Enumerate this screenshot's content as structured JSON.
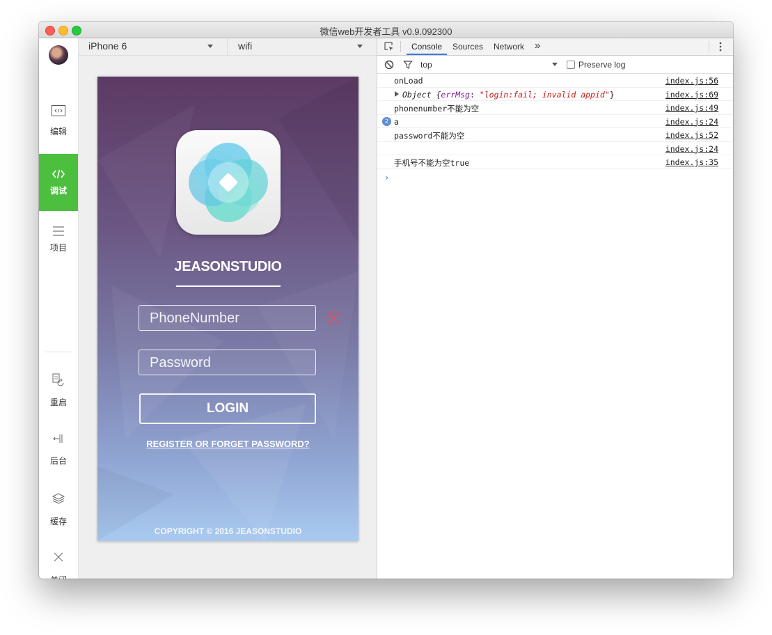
{
  "window": {
    "title": "微信web开发者工具 v0.9.092300"
  },
  "sidebar": {
    "items": [
      {
        "label": "编辑",
        "icon": "code-box-icon"
      },
      {
        "label": "调试",
        "icon": "debug-code-icon"
      },
      {
        "label": "项目",
        "icon": "menu-lines-icon"
      },
      {
        "label": "重启",
        "icon": "restart-icon"
      },
      {
        "label": "后台",
        "icon": "background-icon"
      },
      {
        "label": "缓存",
        "icon": "layers-icon"
      },
      {
        "label": "关闭",
        "icon": "close-icon"
      }
    ],
    "active_color": "#4cbf3f"
  },
  "simulator": {
    "device": "iPhone 6",
    "network": "wifi",
    "app": {
      "brand": "JEASONSTUDIO",
      "phone_placeholder": "PhoneNumber",
      "password_placeholder": "Password",
      "login_label": "LOGIN",
      "register_link": "REGISTER OR FORGET PASSWORD?",
      "copyright": "COPYRIGHT © 2016 JEASONSTUDIO"
    }
  },
  "devtools": {
    "tabs": [
      "Console",
      "Sources",
      "Network"
    ],
    "more": "»",
    "context": "top",
    "preserve_log": "Preserve log",
    "console": [
      {
        "msg": "onLoad",
        "src": "index.js:56"
      },
      {
        "msg_prefix": "Object {",
        "key": "errMsg",
        "sep": ": ",
        "value": "\"login:fail; invalid appid\"",
        "close": "}",
        "src": "index.js:69"
      },
      {
        "msg": "phonenumber不能为空",
        "src": "index.js:49"
      },
      {
        "msg": "a",
        "count": "2",
        "src": "index.js:24"
      },
      {
        "msg": "password不能为空",
        "src": "index.js:52"
      },
      {
        "msg": "",
        "src": "index.js:24"
      },
      {
        "msg": "手机号不能为空true",
        "src": "index.js:35"
      }
    ],
    "prompt": "›"
  }
}
